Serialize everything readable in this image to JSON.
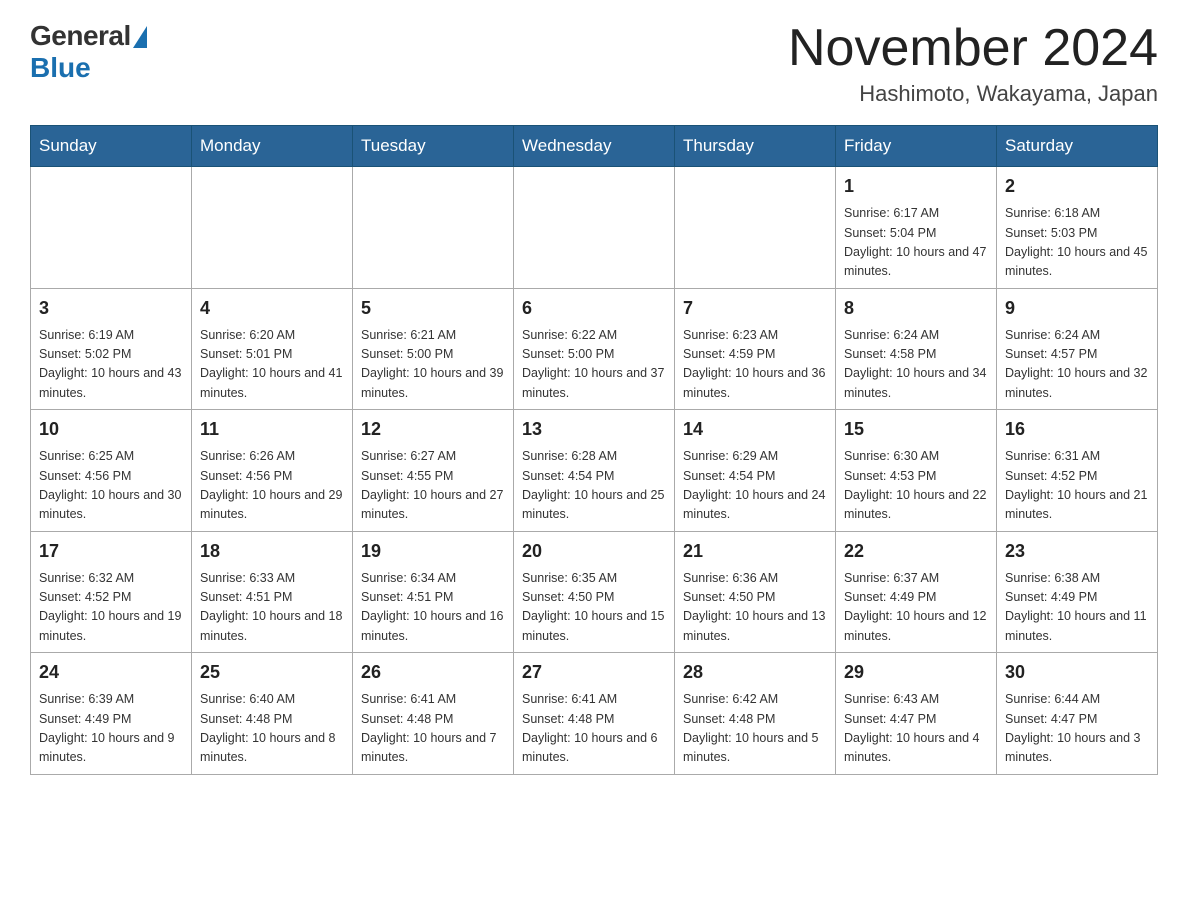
{
  "logo": {
    "general": "General",
    "blue": "Blue"
  },
  "header": {
    "month": "November 2024",
    "location": "Hashimoto, Wakayama, Japan"
  },
  "days_of_week": [
    "Sunday",
    "Monday",
    "Tuesday",
    "Wednesday",
    "Thursday",
    "Friday",
    "Saturday"
  ],
  "weeks": [
    [
      {
        "day": "",
        "info": ""
      },
      {
        "day": "",
        "info": ""
      },
      {
        "day": "",
        "info": ""
      },
      {
        "day": "",
        "info": ""
      },
      {
        "day": "",
        "info": ""
      },
      {
        "day": "1",
        "info": "Sunrise: 6:17 AM\nSunset: 5:04 PM\nDaylight: 10 hours and 47 minutes."
      },
      {
        "day": "2",
        "info": "Sunrise: 6:18 AM\nSunset: 5:03 PM\nDaylight: 10 hours and 45 minutes."
      }
    ],
    [
      {
        "day": "3",
        "info": "Sunrise: 6:19 AM\nSunset: 5:02 PM\nDaylight: 10 hours and 43 minutes."
      },
      {
        "day": "4",
        "info": "Sunrise: 6:20 AM\nSunset: 5:01 PM\nDaylight: 10 hours and 41 minutes."
      },
      {
        "day": "5",
        "info": "Sunrise: 6:21 AM\nSunset: 5:00 PM\nDaylight: 10 hours and 39 minutes."
      },
      {
        "day": "6",
        "info": "Sunrise: 6:22 AM\nSunset: 5:00 PM\nDaylight: 10 hours and 37 minutes."
      },
      {
        "day": "7",
        "info": "Sunrise: 6:23 AM\nSunset: 4:59 PM\nDaylight: 10 hours and 36 minutes."
      },
      {
        "day": "8",
        "info": "Sunrise: 6:24 AM\nSunset: 4:58 PM\nDaylight: 10 hours and 34 minutes."
      },
      {
        "day": "9",
        "info": "Sunrise: 6:24 AM\nSunset: 4:57 PM\nDaylight: 10 hours and 32 minutes."
      }
    ],
    [
      {
        "day": "10",
        "info": "Sunrise: 6:25 AM\nSunset: 4:56 PM\nDaylight: 10 hours and 30 minutes."
      },
      {
        "day": "11",
        "info": "Sunrise: 6:26 AM\nSunset: 4:56 PM\nDaylight: 10 hours and 29 minutes."
      },
      {
        "day": "12",
        "info": "Sunrise: 6:27 AM\nSunset: 4:55 PM\nDaylight: 10 hours and 27 minutes."
      },
      {
        "day": "13",
        "info": "Sunrise: 6:28 AM\nSunset: 4:54 PM\nDaylight: 10 hours and 25 minutes."
      },
      {
        "day": "14",
        "info": "Sunrise: 6:29 AM\nSunset: 4:54 PM\nDaylight: 10 hours and 24 minutes."
      },
      {
        "day": "15",
        "info": "Sunrise: 6:30 AM\nSunset: 4:53 PM\nDaylight: 10 hours and 22 minutes."
      },
      {
        "day": "16",
        "info": "Sunrise: 6:31 AM\nSunset: 4:52 PM\nDaylight: 10 hours and 21 minutes."
      }
    ],
    [
      {
        "day": "17",
        "info": "Sunrise: 6:32 AM\nSunset: 4:52 PM\nDaylight: 10 hours and 19 minutes."
      },
      {
        "day": "18",
        "info": "Sunrise: 6:33 AM\nSunset: 4:51 PM\nDaylight: 10 hours and 18 minutes."
      },
      {
        "day": "19",
        "info": "Sunrise: 6:34 AM\nSunset: 4:51 PM\nDaylight: 10 hours and 16 minutes."
      },
      {
        "day": "20",
        "info": "Sunrise: 6:35 AM\nSunset: 4:50 PM\nDaylight: 10 hours and 15 minutes."
      },
      {
        "day": "21",
        "info": "Sunrise: 6:36 AM\nSunset: 4:50 PM\nDaylight: 10 hours and 13 minutes."
      },
      {
        "day": "22",
        "info": "Sunrise: 6:37 AM\nSunset: 4:49 PM\nDaylight: 10 hours and 12 minutes."
      },
      {
        "day": "23",
        "info": "Sunrise: 6:38 AM\nSunset: 4:49 PM\nDaylight: 10 hours and 11 minutes."
      }
    ],
    [
      {
        "day": "24",
        "info": "Sunrise: 6:39 AM\nSunset: 4:49 PM\nDaylight: 10 hours and 9 minutes."
      },
      {
        "day": "25",
        "info": "Sunrise: 6:40 AM\nSunset: 4:48 PM\nDaylight: 10 hours and 8 minutes."
      },
      {
        "day": "26",
        "info": "Sunrise: 6:41 AM\nSunset: 4:48 PM\nDaylight: 10 hours and 7 minutes."
      },
      {
        "day": "27",
        "info": "Sunrise: 6:41 AM\nSunset: 4:48 PM\nDaylight: 10 hours and 6 minutes."
      },
      {
        "day": "28",
        "info": "Sunrise: 6:42 AM\nSunset: 4:48 PM\nDaylight: 10 hours and 5 minutes."
      },
      {
        "day": "29",
        "info": "Sunrise: 6:43 AM\nSunset: 4:47 PM\nDaylight: 10 hours and 4 minutes."
      },
      {
        "day": "30",
        "info": "Sunrise: 6:44 AM\nSunset: 4:47 PM\nDaylight: 10 hours and 3 minutes."
      }
    ]
  ]
}
